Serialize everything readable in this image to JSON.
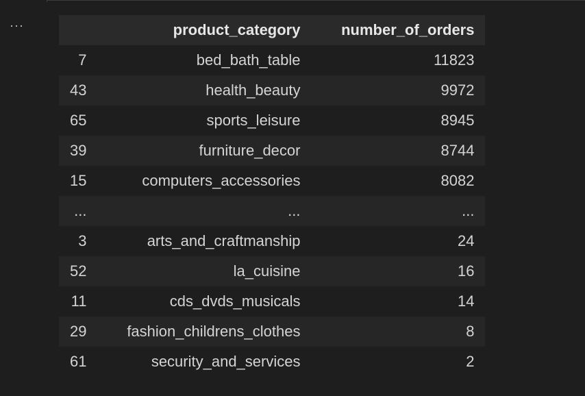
{
  "output": {
    "more_actions_label": "..."
  },
  "table": {
    "headers": {
      "index": "",
      "category": "product_category",
      "orders": "number_of_orders"
    },
    "rows": [
      {
        "index": "7",
        "category": "bed_bath_table",
        "orders": "11823"
      },
      {
        "index": "43",
        "category": "health_beauty",
        "orders": "9972"
      },
      {
        "index": "65",
        "category": "sports_leisure",
        "orders": "8945"
      },
      {
        "index": "39",
        "category": "furniture_decor",
        "orders": "8744"
      },
      {
        "index": "15",
        "category": "computers_accessories",
        "orders": "8082"
      },
      {
        "index": "...",
        "category": "...",
        "orders": "..."
      },
      {
        "index": "3",
        "category": "arts_and_craftmanship",
        "orders": "24"
      },
      {
        "index": "52",
        "category": "la_cuisine",
        "orders": "16"
      },
      {
        "index": "11",
        "category": "cds_dvds_musicals",
        "orders": "14"
      },
      {
        "index": "29",
        "category": "fashion_childrens_clothes",
        "orders": "8"
      },
      {
        "index": "61",
        "category": "security_and_services",
        "orders": "2"
      }
    ]
  }
}
